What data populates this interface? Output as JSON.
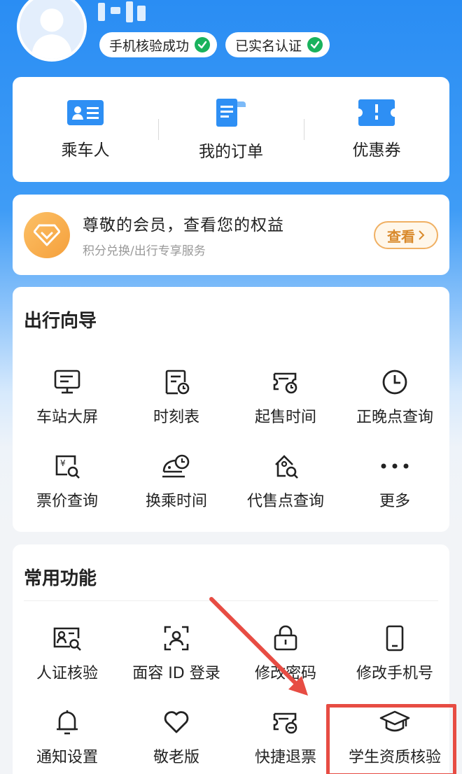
{
  "profile": {
    "phone_verified": "手机核验成功",
    "real_name": "已实名认证"
  },
  "quick_entries": [
    {
      "label": "乘车人",
      "icon": "passenger-card-icon"
    },
    {
      "label": "我的订单",
      "icon": "order-doc-icon"
    },
    {
      "label": "优惠券",
      "icon": "coupon-icon"
    }
  ],
  "member": {
    "title": "尊敬的会员，查看您的权益",
    "subtitle": "积分兑换/出行专享服务",
    "button": "查看"
  },
  "travel_guide": {
    "title": "出行向导",
    "items": [
      {
        "label": "车站大屏",
        "icon": "monitor-icon"
      },
      {
        "label": "时刻表",
        "icon": "timetable-icon"
      },
      {
        "label": "起售时间",
        "icon": "ticket-clock-icon"
      },
      {
        "label": "正晚点查询",
        "icon": "clock-icon"
      },
      {
        "label": "票价查询",
        "icon": "price-search-icon"
      },
      {
        "label": "换乘时间",
        "icon": "train-clock-icon"
      },
      {
        "label": "代售点查询",
        "icon": "house-search-icon"
      },
      {
        "label": "更多",
        "icon": "more-dots-icon"
      }
    ]
  },
  "common_functions": {
    "title": "常用功能",
    "items": [
      {
        "label": "人证核验",
        "icon": "id-card-search-icon"
      },
      {
        "label": "面容 ID 登录",
        "icon": "face-id-icon"
      },
      {
        "label": "修改密码",
        "icon": "lock-icon"
      },
      {
        "label": "修改手机号",
        "icon": "phone-icon"
      },
      {
        "label": "通知设置",
        "icon": "bell-icon"
      },
      {
        "label": "敬老版",
        "icon": "heart-icon"
      },
      {
        "label": "快捷退票",
        "icon": "ticket-refund-icon"
      },
      {
        "label": "学生资质核验",
        "icon": "graduation-cap-icon"
      }
    ]
  },
  "colors": {
    "brand_blue": "#2a8df3",
    "verified_green": "#19b25d",
    "vip_orange": "#f5a03c",
    "annotation_red": "#e74c43"
  }
}
